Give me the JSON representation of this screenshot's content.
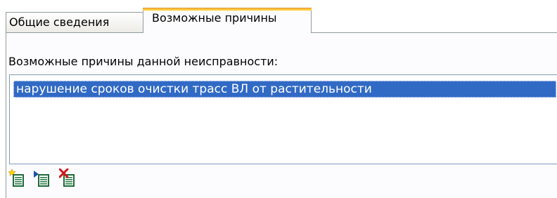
{
  "tabs": [
    {
      "label": "Общие сведения",
      "active": false
    },
    {
      "label": "Возможные причины",
      "active": true
    }
  ],
  "panel": {
    "caption": "Возможные причины данной неисправности:",
    "causes": [
      {
        "text": "нарушение сроков очистки трасс ВЛ от растительности",
        "selected": true
      }
    ]
  },
  "toolbar": {
    "buttons": [
      {
        "icon": "add-item-icon"
      },
      {
        "icon": "select-item-icon"
      },
      {
        "icon": "delete-item-icon"
      }
    ]
  },
  "colors": {
    "selection": "#316ac5",
    "active_tab_highlight": "#ffc83c",
    "border": "#919b9c",
    "listbox_border": "#7f9db9"
  }
}
